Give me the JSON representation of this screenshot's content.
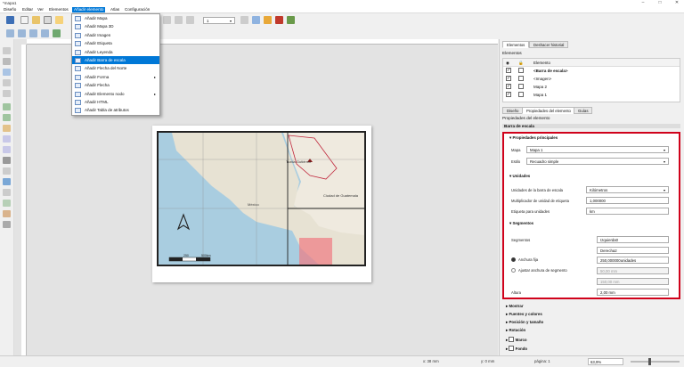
{
  "window": {
    "title": "*mapa1",
    "controls": [
      "–",
      "□",
      "✕"
    ]
  },
  "menubar": [
    "Diseño",
    "Editar",
    "Ver",
    "Elementos",
    "Añadir elemento",
    "Atlas",
    "Configuración"
  ],
  "dropdown": [
    {
      "label": "Añadir Mapa"
    },
    {
      "label": "Añadir Mapa 3D"
    },
    {
      "label": "Añadir Imagen"
    },
    {
      "label": "Añadir Etiqueta"
    },
    {
      "label": "Añadir Leyenda"
    },
    {
      "label": "Añadir Barra de escala"
    },
    {
      "label": "Añadir Flecha del Norte"
    },
    {
      "label": "Añadir Forma",
      "arrow": "▸"
    },
    {
      "label": "Añadir Flecha"
    },
    {
      "label": "Añadir Elemento nodo",
      "arrow": "▸"
    },
    {
      "label": "Añadir HTML"
    },
    {
      "label": "Añadir Tabla de atributos"
    }
  ],
  "toolbar": {
    "page_select": "1"
  },
  "map": {
    "city1": "Ciudad de Guatemala",
    "city2": "Tuxtla Gutiérrez",
    "mexico": "México",
    "scale_label": "250",
    "scale_label2": "500km"
  },
  "right_panel": {
    "tabs": [
      "Elementos",
      "Deshacer historial"
    ],
    "elements_title": "Elementos",
    "elements_header": "Elemento",
    "elements": [
      "<Barra de escala>",
      "<Imagen>",
      "Mapa 2",
      "Mapa 1"
    ],
    "bottom_tabs": [
      "Diseño",
      "Propiedades del elemento",
      "Guías"
    ],
    "props_title": "Propiedades del elemento",
    "props_sub": "Barra de escala"
  },
  "props": {
    "main_section": "Propiedades principales",
    "map_label": "Mapa",
    "map_value": "Mapa 1",
    "style_label": "Estilo",
    "style_value": "Recuadro simple",
    "units_section": "Unidades",
    "unit_label": "Unidades de la barra de escala",
    "unit_value": "Kilómetros",
    "mult_label": "Multiplicador de unidad de etiqueta",
    "mult_value": "1,000000",
    "unitlabel_label": "Etiqueta para unidades",
    "unitlabel_value": "km",
    "seg_section": "Segmentos",
    "segments_label": "Segmentos",
    "left_value": "Izquierda0",
    "right_value": "Derecha2",
    "fixed_label": "Anchura fija",
    "fixed_value": "250,000000unidades",
    "fit_label": "Ajustar anchura de segmento",
    "fit_min": "50,00 mm",
    "fit_max": "150,00 mm",
    "height_label": "Altura",
    "height_value": "2,00 mm"
  },
  "collapsed_sections": [
    "Mostrar",
    "Fuentes y colores",
    "Posición y tamaño",
    "Rotación",
    "Marco",
    "Fondo"
  ],
  "status": {
    "x": "x: 38 mm",
    "y": "y: 0 mm",
    "page": "página: 1",
    "zoom": "63,9%"
  }
}
